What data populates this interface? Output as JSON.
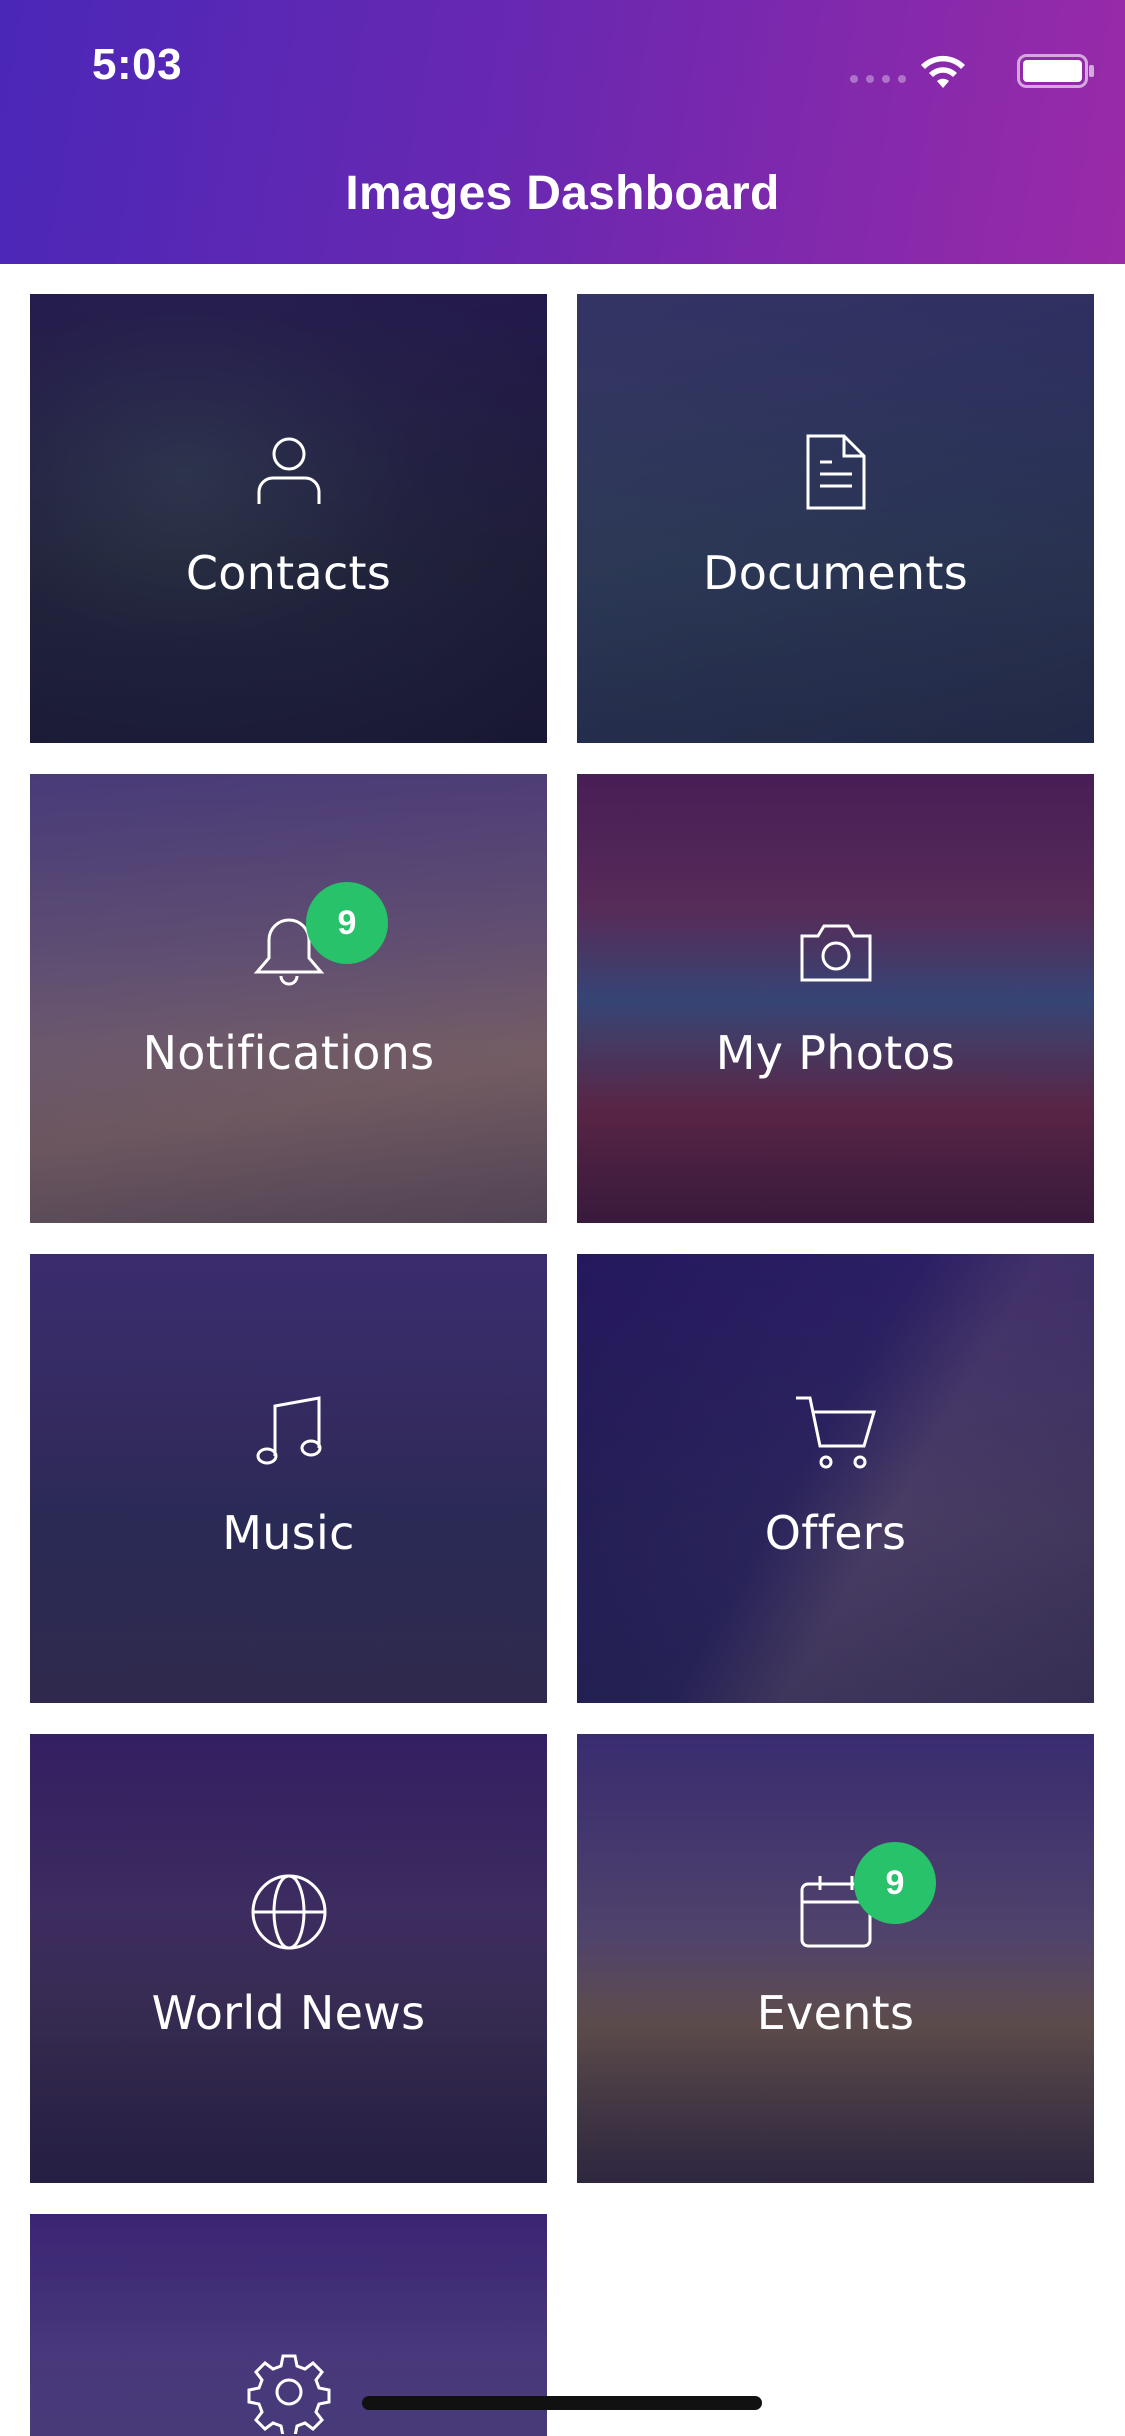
{
  "status_bar": {
    "time": "5:03"
  },
  "header": {
    "title": "Images Dashboard"
  },
  "tiles": [
    {
      "label": "Contacts",
      "icon": "person-icon",
      "badge": null
    },
    {
      "label": "Documents",
      "icon": "document-icon",
      "badge": null
    },
    {
      "label": "Notifications",
      "icon": "bell-icon",
      "badge": "9"
    },
    {
      "label": "My Photos",
      "icon": "camera-icon",
      "badge": null
    },
    {
      "label": "Music",
      "icon": "music-note-icon",
      "badge": null
    },
    {
      "label": "Offers",
      "icon": "cart-icon",
      "badge": null
    },
    {
      "label": "World News",
      "icon": "globe-icon",
      "badge": null
    },
    {
      "label": "Events",
      "icon": "calendar-icon",
      "badge": "9"
    },
    {
      "label": "",
      "icon": "gear-icon",
      "badge": null
    }
  ],
  "colors": {
    "header_gradient_start": "#4a27b8",
    "header_gradient_end": "#9a2aa8",
    "badge": "#27c26a"
  }
}
